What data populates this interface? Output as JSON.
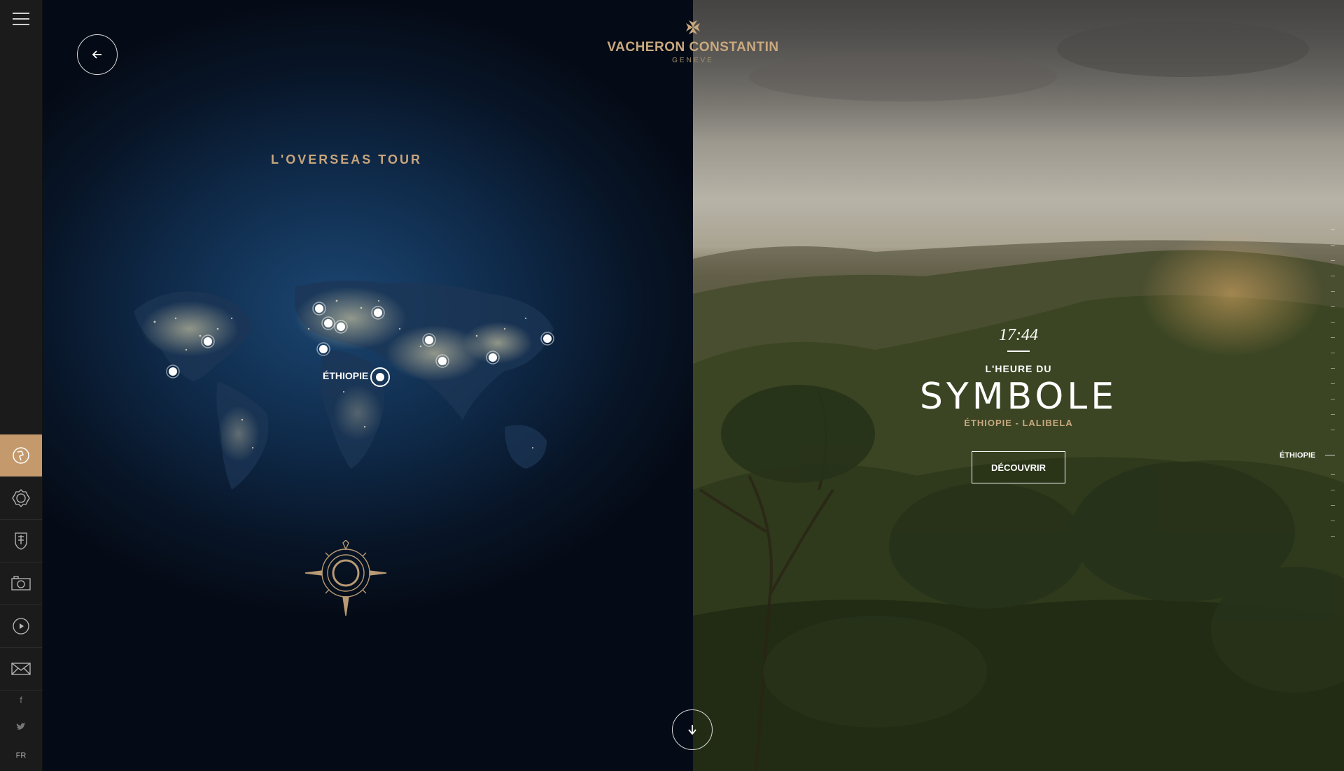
{
  "brand": {
    "name": "VACHERON CONSTANTIN",
    "city": "GENEVE",
    "accent_color": "#c49a6c"
  },
  "sidebar": {
    "menu_icon": "hamburger-icon",
    "items": [
      {
        "icon": "globe-icon",
        "active": true
      },
      {
        "icon": "watch-icon",
        "active": false
      },
      {
        "icon": "crest-icon",
        "active": false
      },
      {
        "icon": "camera-icon",
        "active": false
      },
      {
        "icon": "play-icon",
        "active": false
      },
      {
        "icon": "mail-icon",
        "active": false
      }
    ],
    "social": [
      {
        "icon": "facebook-icon",
        "label": "f"
      },
      {
        "icon": "twitter-icon",
        "label": "t"
      }
    ],
    "language": "FR"
  },
  "map_panel": {
    "title": "L'OVERSEAS TOUR",
    "active_marker_label": "ÉTHIOPIE",
    "back_icon": "arrow-left-icon",
    "compass_icon": "compass-rose-icon"
  },
  "story": {
    "time": "17:44",
    "subtitle": "L'HEURE DU",
    "headline": "SYMBOLE",
    "location": "ÉTHIOPIE - LALIBELA",
    "cta_label": "DÉCOUVRIR",
    "timeline_label": "ÉTHIOPIE"
  },
  "scroll": {
    "icon": "arrow-down-icon"
  }
}
